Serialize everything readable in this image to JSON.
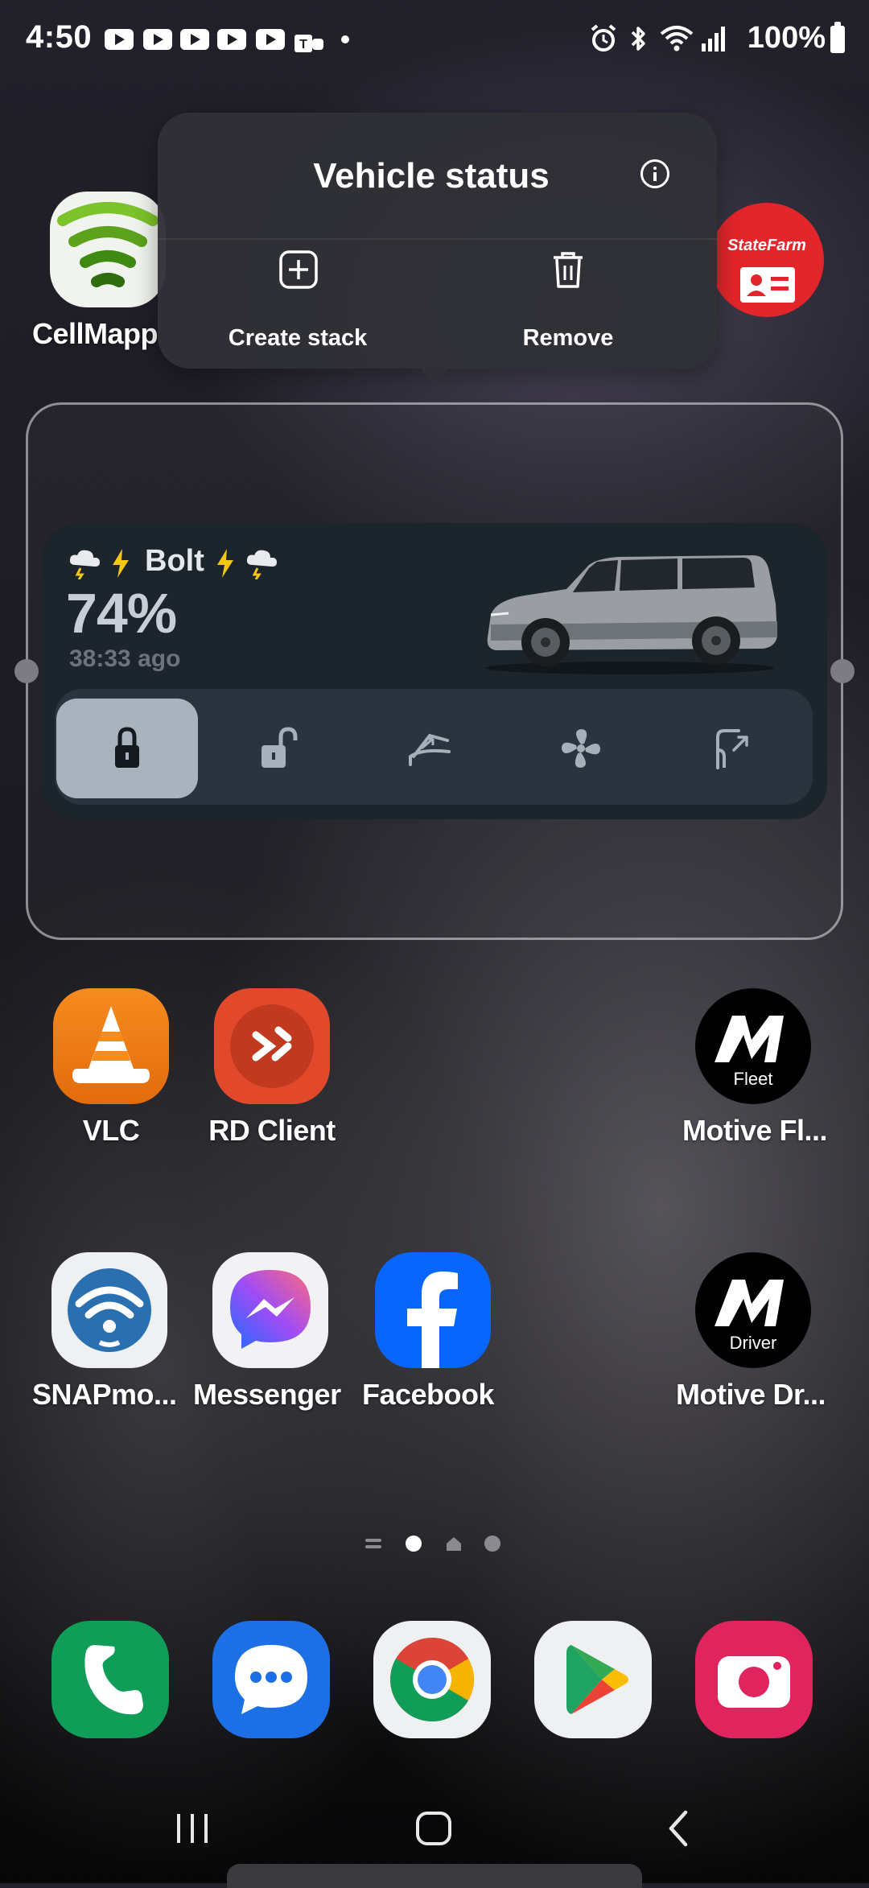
{
  "status_bar": {
    "time": "4:50",
    "notification_icons": [
      "youtube-icon",
      "youtube-icon",
      "youtube-icon",
      "youtube-icon",
      "youtube-icon",
      "teams-icon",
      "dot-icon"
    ],
    "system_icons": [
      "alarm-icon",
      "bluetooth-icon",
      "wifi-icon",
      "signal-icon"
    ],
    "battery_text": "100%"
  },
  "popup": {
    "title": "Vehicle status",
    "info_icon": "info-icon",
    "actions": [
      {
        "label": "Create stack",
        "icon": "add-box-icon"
      },
      {
        "label": "Remove",
        "icon": "trash-icon"
      }
    ]
  },
  "apps_top": [
    {
      "label": "CellMapp",
      "icon": "cellmapper-icon"
    },
    {
      "label": "",
      "icon": "statefarm-icon",
      "logo_text": "StateFarm"
    }
  ],
  "widget": {
    "vehicle_name": "Bolt",
    "weather_icons": [
      "storm-cloud-icon",
      "lightning-icon",
      "lightning-icon",
      "storm-cloud-icon"
    ],
    "battery_percent": "74%",
    "updated": "38:33 ago",
    "controls": [
      {
        "name": "lock",
        "icon": "lock-icon",
        "active": true
      },
      {
        "name": "unlock",
        "icon": "unlock-icon",
        "active": false
      },
      {
        "name": "frunk",
        "icon": "frunk-icon",
        "active": false
      },
      {
        "name": "climate",
        "icon": "fan-icon",
        "active": false
      },
      {
        "name": "charge-port",
        "icon": "charge-port-icon",
        "active": false
      }
    ]
  },
  "apps_row1": [
    {
      "label": "VLC",
      "icon": "vlc-icon"
    },
    {
      "label": "RD Client",
      "icon": "rd-client-icon"
    },
    {
      "label": "Motive Fl...",
      "icon": "motive-fleet-icon",
      "badge": "Fleet"
    }
  ],
  "apps_row2": [
    {
      "label": "SNAPmo...",
      "icon": "snapmobile-icon"
    },
    {
      "label": "Messenger",
      "icon": "messenger-icon"
    },
    {
      "label": "Facebook",
      "icon": "facebook-icon"
    },
    {
      "label": "Motive Dr...",
      "icon": "motive-driver-icon",
      "badge": "Driver"
    }
  ],
  "page_indicator": {
    "pages": 4,
    "current": 1
  },
  "dock": [
    {
      "name": "phone",
      "icon": "phone-icon"
    },
    {
      "name": "messages",
      "icon": "messages-icon"
    },
    {
      "name": "chrome",
      "icon": "chrome-icon"
    },
    {
      "name": "play-store",
      "icon": "play-store-icon"
    },
    {
      "name": "camera",
      "icon": "camera-icon"
    }
  ],
  "nav": [
    "recents-icon",
    "home-icon",
    "back-icon"
  ]
}
